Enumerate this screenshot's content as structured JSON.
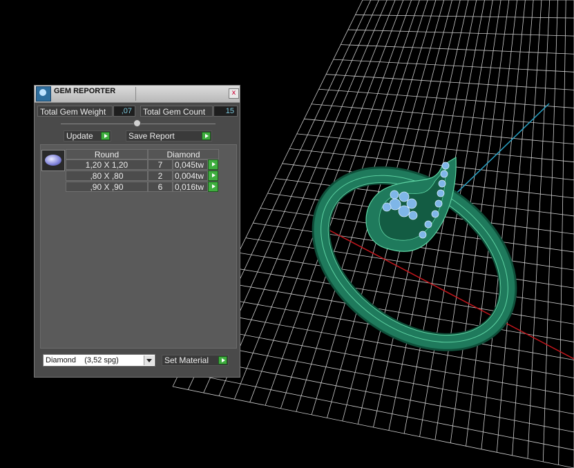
{
  "viewport": {
    "grid_color": "#cfcfcf",
    "axis_x_color": "#c4161c",
    "axis_y_color": "#2aa3c6",
    "ring_color": "#1f7a5c",
    "ring_edge_color": "#5fd4a4",
    "stone_color": "#7fb6e8"
  },
  "gem_reporter": {
    "title": "GEM REPORTER",
    "close_label": "x",
    "total_weight_label": "Total Gem Weight",
    "total_weight_value": ",07",
    "total_count_label": "Total Gem Count",
    "total_count_value": "15",
    "update_label": "Update",
    "save_report_label": "Save Report",
    "table": {
      "headers": [
        "Round",
        "Diamond"
      ],
      "rows": [
        {
          "size": "1,20 X 1,20",
          "count": "7",
          "weight": "0,045tw"
        },
        {
          "size": ",80 X ,80",
          "count": "2",
          "weight": "0,004tw"
        },
        {
          "size": ",90 X ,90",
          "count": "6",
          "weight": "0,016tw"
        }
      ]
    },
    "material_select_value": "Diamond    (3,52 spg)",
    "set_material_label": "Set Material"
  }
}
